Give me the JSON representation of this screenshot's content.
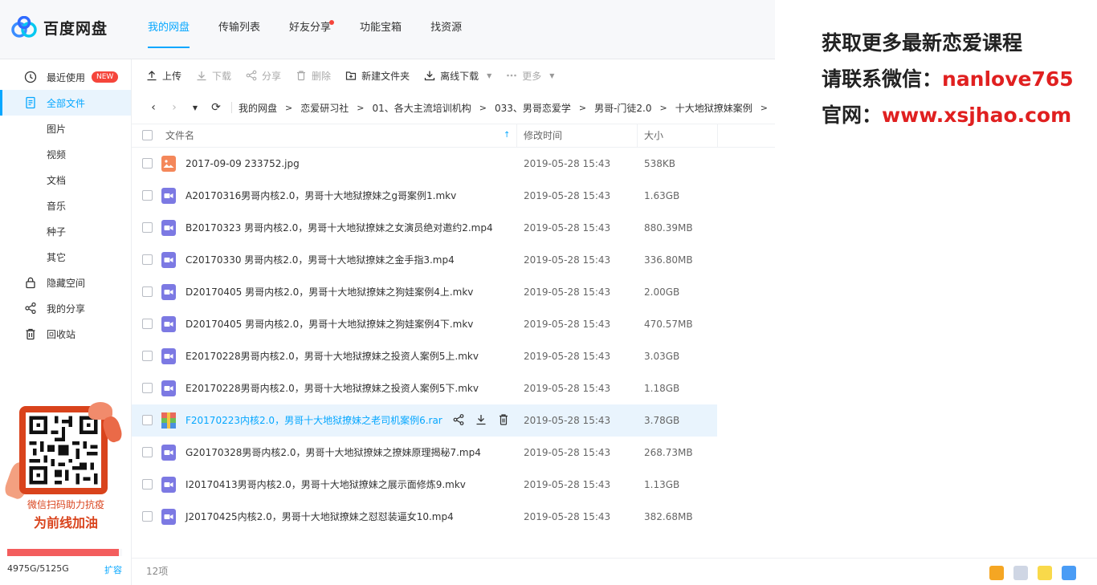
{
  "app": {
    "name": "百度网盘"
  },
  "nav": {
    "tabs": [
      {
        "label": "我的网盘",
        "active": true
      },
      {
        "label": "传输列表"
      },
      {
        "label": "好友分享",
        "dot": true
      },
      {
        "label": "功能宝箱"
      },
      {
        "label": "找资源"
      }
    ]
  },
  "promo": {
    "line1": "获取更多最新恋爱课程",
    "line2_prefix": "请联系微信：",
    "line2_value": "nanlove765",
    "line3_prefix": "官网：",
    "line3_value": "www.xsjhao.com"
  },
  "sidebar": {
    "items": [
      {
        "label": "最近使用",
        "icon": "clock-icon",
        "badge": "NEW"
      },
      {
        "label": "全部文件",
        "icon": "document-icon",
        "active": true
      },
      {
        "label": "图片"
      },
      {
        "label": "视频"
      },
      {
        "label": "文档"
      },
      {
        "label": "音乐"
      },
      {
        "label": "种子"
      },
      {
        "label": "其它"
      },
      {
        "label": "隐藏空间",
        "icon": "lock-icon"
      },
      {
        "label": "我的分享",
        "icon": "share-icon"
      },
      {
        "label": "回收站",
        "icon": "trash-icon"
      }
    ],
    "promo_text1": "微信扫码助力抗疫",
    "promo_text2": "为前线加油",
    "quota": {
      "used_fraction": 0.971,
      "text": "4975G/5125G",
      "expand_label": "扩容"
    }
  },
  "toolbar": {
    "upload": "上传",
    "download": "下载",
    "share": "分享",
    "delete": "删除",
    "new_folder": "新建文件夹",
    "offline_download": "离线下载",
    "more": "更多"
  },
  "breadcrumb": [
    "我的网盘",
    "恋爱研习社",
    "01、各大主流培训机构",
    "033、男哥恋爱学",
    "男哥-门徒2.0",
    "十大地狱撩妹案例"
  ],
  "table": {
    "headers": {
      "name": "文件名",
      "modified": "修改时间",
      "size": "大小"
    },
    "rows": [
      {
        "name": "2017-09-09 233752.jpg",
        "time": "2019-05-28 15:43",
        "size": "538KB",
        "type": "image"
      },
      {
        "name": "A20170316男哥内核2.0，男哥十大地狱撩妹之g哥案例1.mkv",
        "time": "2019-05-28 15:43",
        "size": "1.63GB",
        "type": "video"
      },
      {
        "name": "B20170323 男哥内核2.0，男哥十大地狱撩妹之女演员绝对邀约2.mp4",
        "time": "2019-05-28 15:43",
        "size": "880.39MB",
        "type": "video"
      },
      {
        "name": "C20170330 男哥内核2.0，男哥十大地狱撩妹之金手指3.mp4",
        "time": "2019-05-28 15:43",
        "size": "336.80MB",
        "type": "video"
      },
      {
        "name": "D20170405 男哥内核2.0，男哥十大地狱撩妹之狗娃案例4上.mkv",
        "time": "2019-05-28 15:43",
        "size": "2.00GB",
        "type": "video"
      },
      {
        "name": "D20170405 男哥内核2.0，男哥十大地狱撩妹之狗娃案例4下.mkv",
        "time": "2019-05-28 15:43",
        "size": "470.57MB",
        "type": "video"
      },
      {
        "name": "E20170228男哥内核2.0，男哥十大地狱撩妹之投资人案例5上.mkv",
        "time": "2019-05-28 15:43",
        "size": "3.03GB",
        "type": "video"
      },
      {
        "name": "E20170228男哥内核2.0，男哥十大地狱撩妹之投资人案例5下.mkv",
        "time": "2019-05-28 15:43",
        "size": "1.18GB",
        "type": "video"
      },
      {
        "name": "F20170223内核2.0，男哥十大地狱撩妹之老司机案例6.rar",
        "time": "2019-05-28 15:43",
        "size": "3.78GB",
        "type": "archive",
        "hover": true
      },
      {
        "name": "G20170328男哥内核2.0，男哥十大地狱撩妹之撩妹原理揭秘7.mp4",
        "time": "2019-05-28 15:43",
        "size": "268.73MB",
        "type": "video"
      },
      {
        "name": "I20170413男哥内核2.0，男哥十大地狱撩妹之展示面修炼9.mkv",
        "time": "2019-05-28 15:43",
        "size": "1.13GB",
        "type": "video"
      },
      {
        "name": "J20170425内核2.0，男哥十大地狱撩妹之怼怼装逼女10.mp4",
        "time": "2019-05-28 15:43",
        "size": "382.68MB",
        "type": "video"
      }
    ]
  },
  "status": {
    "count": "12项"
  },
  "colors": {
    "accent": "#06a7ff",
    "quota_red": "#f35d5d",
    "promo_red": "#e02020"
  }
}
